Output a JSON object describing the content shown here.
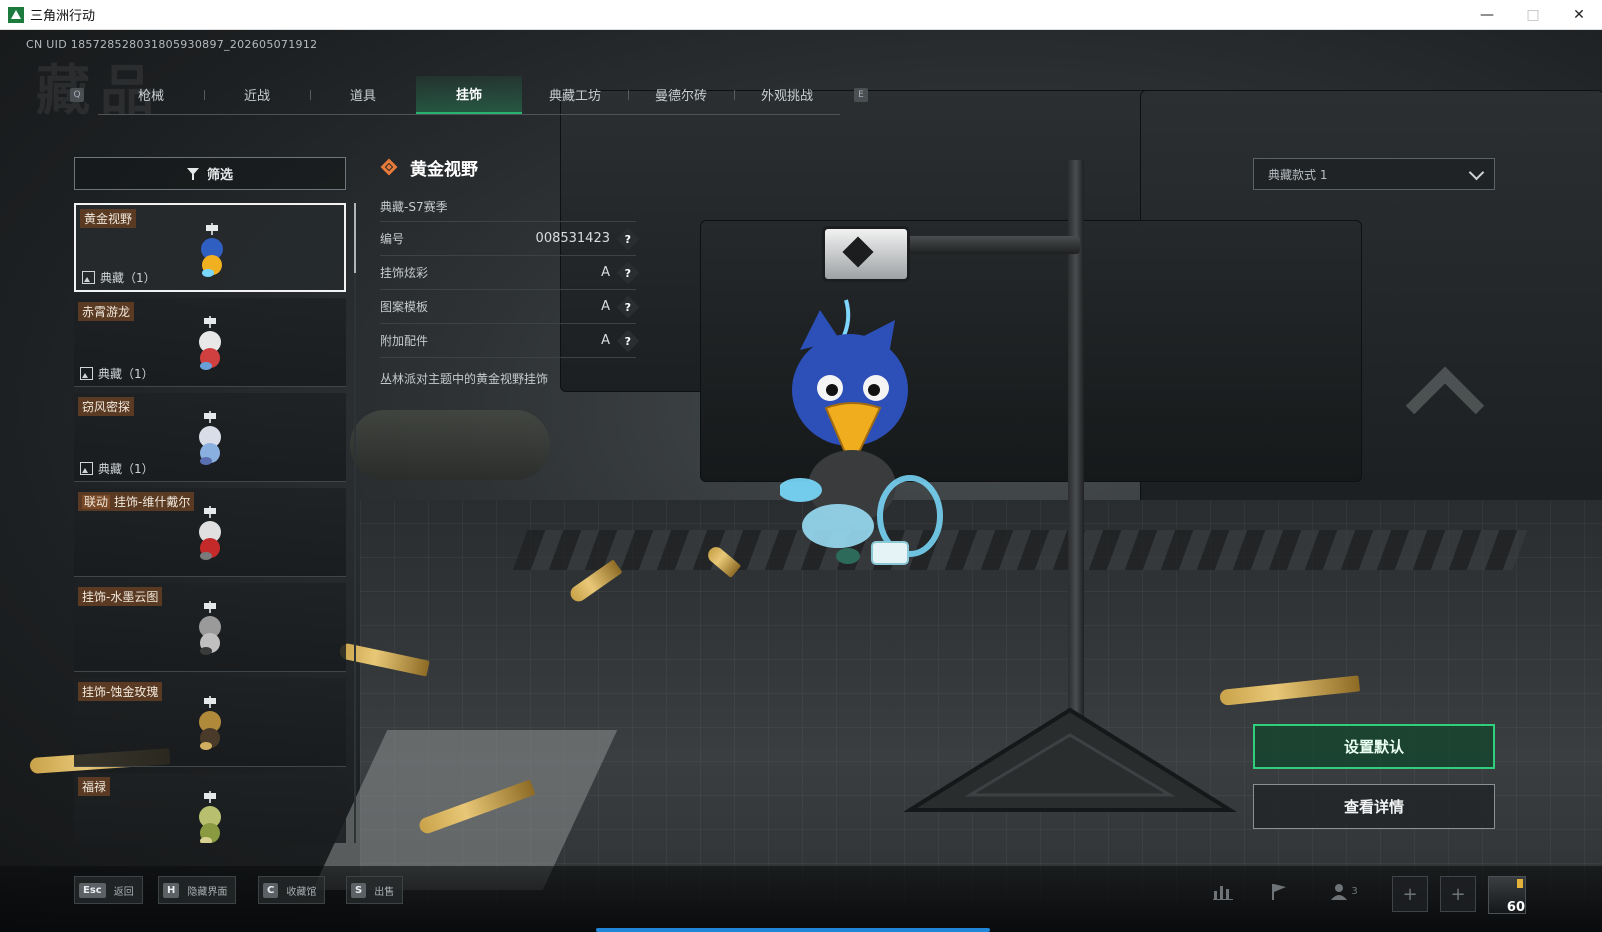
{
  "window": {
    "title": "三角洲行动",
    "controls": [
      "minimize-icon",
      "maximize-icon",
      "close-icon"
    ]
  },
  "uid": "CN UID 185728528031805930897_202605071912",
  "watermark": "藏品",
  "tabs": {
    "prev_key": "Q",
    "next_key": "E",
    "items": [
      {
        "label": "枪械",
        "active": false
      },
      {
        "label": "近战",
        "active": false
      },
      {
        "label": "道具",
        "active": false
      },
      {
        "label": "挂饰",
        "active": true
      },
      {
        "label": "典藏工坊",
        "active": false
      },
      {
        "label": "曼德尔砖",
        "active": false
      },
      {
        "label": "外观挑战",
        "active": false
      }
    ]
  },
  "filter": {
    "label": "筛选",
    "icon": "filter-icon"
  },
  "items": [
    {
      "name": "黄金视野",
      "tag": "",
      "meta": "典藏（1）",
      "selected": true,
      "thumb_colors": [
        "#2f5fc0",
        "#f0b020",
        "#7ad8ff"
      ]
    },
    {
      "name": "赤霄游龙",
      "tag": "",
      "meta": "典藏（1）",
      "selected": false,
      "thumb_colors": [
        "#e8e8e8",
        "#d04040",
        "#6aa0d8"
      ]
    },
    {
      "name": "窃风密探",
      "tag": "",
      "meta": "典藏（1）",
      "selected": false,
      "thumb_colors": [
        "#d8dde8",
        "#8ab0e0",
        "#5a6fb0"
      ]
    },
    {
      "name": "挂饰-维什戴尔",
      "tag": "联动",
      "meta": "",
      "selected": false,
      "thumb_colors": [
        "#e0e0e0",
        "#c42a2a",
        "#7a7a7a"
      ]
    },
    {
      "name": "挂饰-水墨云图",
      "tag": "",
      "meta": "",
      "selected": false,
      "thumb_colors": [
        "#9a9a9a",
        "#c0c0c0",
        "#3a3a3a"
      ]
    },
    {
      "name": "挂饰-蚀金玫瑰",
      "tag": "",
      "meta": "",
      "selected": false,
      "thumb_colors": [
        "#b08a3a",
        "#4a3a2a",
        "#d0b060"
      ]
    },
    {
      "name": "福禄",
      "tag": "",
      "meta": "",
      "selected": false,
      "thumb_colors": [
        "#b8c070",
        "#8a9a40",
        "#d8d090"
      ]
    }
  ],
  "detail": {
    "title": "黄金视野",
    "subtitle": "典藏-S7赛季",
    "rows": [
      {
        "label": "编号",
        "value": "008531423"
      },
      {
        "label": "挂饰炫彩",
        "value": "A"
      },
      {
        "label": "图案模板",
        "value": "A"
      },
      {
        "label": "附加配件",
        "value": "A"
      }
    ],
    "help_glyph": "?",
    "description": "丛林派对主题中的黄金视野挂饰"
  },
  "style_select": {
    "value": "典藏款式 1"
  },
  "actions": {
    "set_default": "设置默认",
    "view_details": "查看详情"
  },
  "hotkeys": [
    {
      "key": "Esc",
      "label": "返回"
    },
    {
      "key": "H",
      "label": "隐藏界面"
    },
    {
      "key": "C",
      "label": "收藏馆"
    },
    {
      "key": "S",
      "label": "出售"
    }
  ],
  "status": {
    "squad_count": "3",
    "level": "60"
  },
  "colors": {
    "accent_green": "#2fcf7e",
    "active_tab_underline": "#28b46e",
    "title_orange": "#e87a3a",
    "progress_blue": "#1f86d8"
  }
}
